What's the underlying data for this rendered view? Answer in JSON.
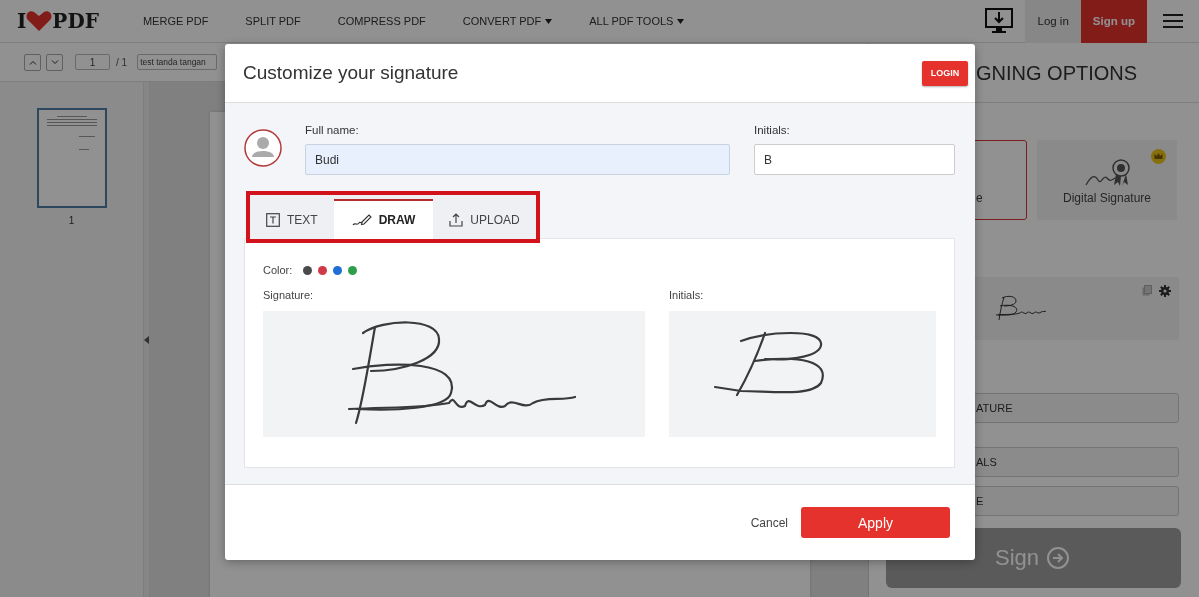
{
  "header": {
    "logo": {
      "left": "I",
      "right": "PDF"
    },
    "nav": [
      {
        "label": "MERGE PDF",
        "dropdown": false
      },
      {
        "label": "SPLIT PDF",
        "dropdown": false
      },
      {
        "label": "COMPRESS PDF",
        "dropdown": false
      },
      {
        "label": "CONVERT PDF",
        "dropdown": true
      },
      {
        "label": "ALL PDF TOOLS",
        "dropdown": true
      }
    ],
    "login": "Log in",
    "signup": "Sign up"
  },
  "toolbar": {
    "page": "1",
    "page_total": "/ 1",
    "file_name": "test tanda tangan"
  },
  "thumbnails": [
    {
      "label": "1",
      "selected": true
    }
  ],
  "signing_options": {
    "title": "GNING OPTIONS",
    "types": [
      {
        "label": "e",
        "selected": true,
        "premium": false
      },
      {
        "label": "Digital Signature",
        "selected": false,
        "premium": true
      }
    ],
    "buttons": [
      "ATURE",
      "ALS",
      "E"
    ],
    "sign_button": {
      "label": "Sign",
      "disabled": true
    }
  },
  "modal": {
    "title": "Customize your signature",
    "login": "LOGIN",
    "full_name": {
      "label": "Full name:",
      "value": "Budi"
    },
    "initials": {
      "label": "Initials:",
      "value": "B"
    },
    "tabs": [
      {
        "kind": "text",
        "label": "TEXT",
        "selected": false
      },
      {
        "kind": "draw",
        "label": "DRAW",
        "selected": true
      },
      {
        "kind": "upload",
        "label": "UPLOAD",
        "selected": false
      }
    ],
    "color_label": "Color:",
    "colors": [
      {
        "color": "#4a4a4a"
      },
      {
        "color": "#d03a46"
      },
      {
        "color": "#1f6fd6"
      },
      {
        "color": "#2f9e4c"
      }
    ],
    "signature_label": "Signature:",
    "initials_label": "Initials:",
    "cancel": "Cancel",
    "apply": "Apply"
  }
}
